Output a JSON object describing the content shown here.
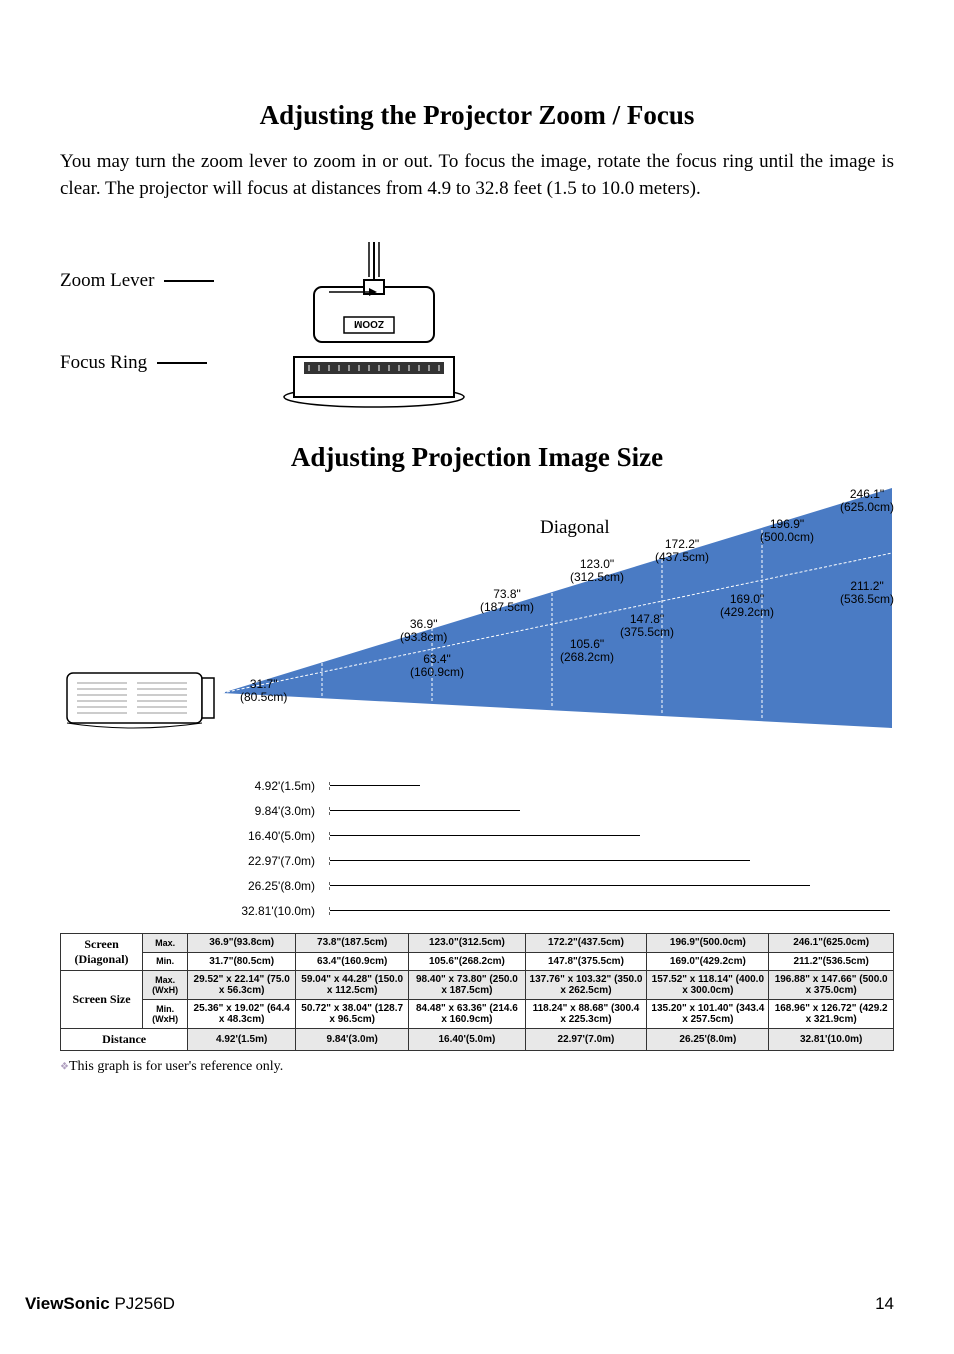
{
  "title1": "Adjusting the Projector Zoom / Focus",
  "body": "You may turn the zoom lever to zoom in or out.  To focus the image, rotate the  focus ring until the image is clear. The projector will focus at distances from 4.9 to 32.8 feet (1.5 to 10.0 meters).",
  "zoom_label": "Zoom Lever",
  "focus_label": "Focus Ring",
  "zoom_text": "ZOOM",
  "title2": "Adjusting Projection Image Size",
  "diagonal_label": "Diagonal",
  "chart_data": {
    "type": "table",
    "diagonal_max": [
      "36.9\"(93.8cm)",
      "73.8\"(187.5cm)",
      "123.0\"(312.5cm)",
      "172.2\"(437.5cm)",
      "196.9\"(500.0cm)",
      "246.1\"(625.0cm)"
    ],
    "diagonal_min": [
      "31.7\"(80.5cm)",
      "63.4\"(160.9cm)",
      "105.6\"(268.2cm)",
      "147.8\"(375.5cm)",
      "169.0\"(429.2cm)",
      "211.2\"(536.5cm)"
    ],
    "size_max": [
      "29.52\" x 22.14\" (75.0 x 56.3cm)",
      "59.04\" x 44.28\" (150.0 x 112.5cm)",
      "98.40\" x 73.80\" (250.0 x 187.5cm)",
      "137.76\" x 103.32\" (350.0 x 262.5cm)",
      "157.52\" x 118.14\" (400.0 x 300.0cm)",
      "196.88\" x 147.66\" (500.0 x 375.0cm)"
    ],
    "size_min": [
      "25.36\" x 19.02\" (64.4 x 48.3cm)",
      "50.72\" x 38.04\" (128.7 x 96.5cm)",
      "84.48\" x 63.36\" (214.6 x 160.9cm)",
      "118.24\" x 88.68\" (300.4 x 225.3cm)",
      "135.20\" x 101.40\" (343.4 x 257.5cm)",
      "168.96\" x 126.72\" (429.2 x 321.9cm)"
    ],
    "distance": [
      "4.92'(1.5m)",
      "9.84'(3.0m)",
      "16.40'(5.0m)",
      "22.97'(7.0m)",
      "26.25'(8.0m)",
      "32.81'(10.0m)"
    ]
  },
  "tri_labels": {
    "d0_top": "36.9\"",
    "d0_bot": "(93.8cm)",
    "d0m_top": "31.7\"",
    "d0m_bot": "(80.5cm)",
    "d1_top": "73.8\"",
    "d1_bot": "(187.5cm)",
    "d1m_top": "63.4\"",
    "d1m_bot": "(160.9cm)",
    "d2_top": "123.0\"",
    "d2_bot": "(312.5cm)",
    "d2m_top": "105.6\"",
    "d2m_bot": "(268.2cm)",
    "d3_top": "172.2\"",
    "d3_bot": "(437.5cm)",
    "d3m_top": "147.8\"",
    "d3m_bot": "(375.5cm)",
    "d4_top": "196.9\"",
    "d4_bot": "(500.0cm)",
    "d4m_top": "169.0\"",
    "d4m_bot": "(429.2cm)",
    "d5_top": "246.1\"",
    "d5_bot": "(625.0cm)",
    "d5m_top": "211.2\"",
    "d5m_bot": "(536.5cm)"
  },
  "table_headers": {
    "screen_diag": "Screen (Diagonal)",
    "screen_size": "Screen Size",
    "distance": "Distance",
    "max": "Max.",
    "min": "Min.",
    "max_wxh": "Max.(WxH)",
    "min_wxh": "Min.(WxH)"
  },
  "footnote": "This graph is for user's reference only.",
  "footer_brand": "ViewSonic",
  "footer_model": " PJ256D",
  "page_num": "14"
}
